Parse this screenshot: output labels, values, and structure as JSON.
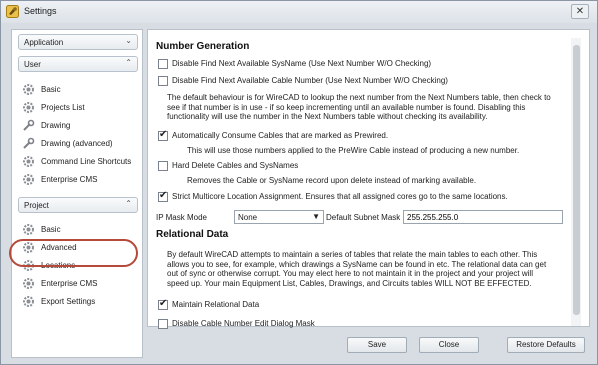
{
  "window": {
    "title": "Settings",
    "close_glyph": "✕"
  },
  "sidebar": {
    "application": {
      "label": "Application",
      "chevron": "⌄"
    },
    "user": {
      "label": "User",
      "chevron": "⌃",
      "items": [
        "Basic",
        "Projects List",
        "Drawing",
        "Drawing (advanced)",
        "Command Line Shortcuts",
        "Enterprise CMS"
      ]
    },
    "project": {
      "label": "Project",
      "chevron": "⌃",
      "items": [
        "Basic",
        "Advanced",
        "Locations",
        "Enterprise CMS",
        "Export Settings"
      ]
    }
  },
  "main": {
    "number_generation": {
      "heading": "Number Generation",
      "opt1": "Disable Find Next Available SysName (Use Next Number W/O Checking)",
      "opt2": "Disable Find Next Available Cable Number (Use Next Number W/O Checking)",
      "desc1": [
        "The default behaviour is for WireCAD to lookup the next number from the Next Numbers table, then check to",
        "see if that number is in use - if so keep incrementing until an available number is found.  Disabling this",
        "functionality will use the number in the Next Numbers table without checking its availability."
      ],
      "opt3": "Automatically Consume Cables that are marked as Prewired.",
      "desc3": "This will use those numbers applied to the PreWire Cable instead of producing a new number.",
      "opt4": "Hard Delete Cables and SysNames",
      "desc4": "Removes the Cable or SysName record upon delete instead of marking available.",
      "opt5": "Strict Multicore Location Assignment. Ensures that all assigned cores go to the same locations.",
      "ip_mask_label": "IP Mask Mode",
      "ip_mask_value": "None",
      "subnet_label": "Default Subnet Mask",
      "subnet_value": "255.255.255.0"
    },
    "relational": {
      "heading": "Relational Data",
      "desc": [
        "By default WireCAD attempts to maintain a series of tables that relate the main tables to each other. This",
        "allows you to see, for example, which drawings a SysName can be found in etc. The relational data can get",
        "out of sync or otherwise corrupt. You may elect here to not maintain it in the project and your project will",
        "speed up. Your main Equipment List, Cables, Drawings, and Circuits tables WILL NOT BE EFFECTED."
      ],
      "opt1": "Maintain Relational Data",
      "opt2": "Disable Cable Number Edit Dialog Mask"
    },
    "checks": {
      "opt1": false,
      "opt2": false,
      "opt3": true,
      "opt4": false,
      "opt5": true,
      "rel1": true,
      "rel2": false
    }
  },
  "buttons": {
    "save": "Save",
    "close": "Close",
    "restore": "Restore Defaults"
  }
}
